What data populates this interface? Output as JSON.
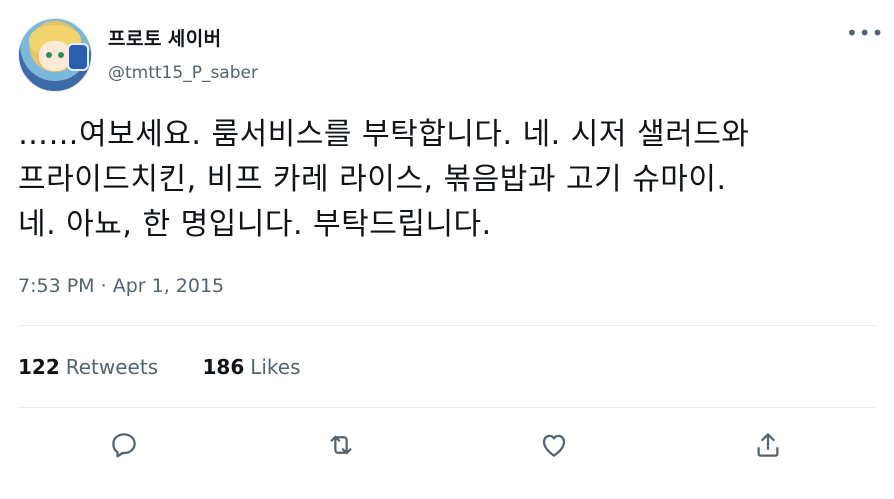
{
  "user": {
    "display_name": "프로토 세이버",
    "handle": "@tmtt15_P_saber"
  },
  "tweet": {
    "lines": [
      "……여보세요. 룸서비스를 부탁합니다. 네. 시저 샐러드와",
      "프라이드치킨, 비프 카레 라이스, 볶음밥과 고기 슈마이.",
      "네. 아뇨, 한 명입니다. 부탁드립니다."
    ],
    "time": "7:53 PM",
    "separator": "·",
    "date": "Apr 1, 2015"
  },
  "stats": {
    "retweets_count": "122",
    "retweets_label": "Retweets",
    "likes_count": "186",
    "likes_label": "Likes"
  },
  "icons": {
    "more": "more-horizontal-icon",
    "reply": "reply-icon",
    "retweet": "retweet-icon",
    "like": "like-icon",
    "share": "share-icon"
  },
  "colors": {
    "text_primary": "#0f1419",
    "text_secondary": "#536471",
    "divider": "#e6ecf0"
  }
}
